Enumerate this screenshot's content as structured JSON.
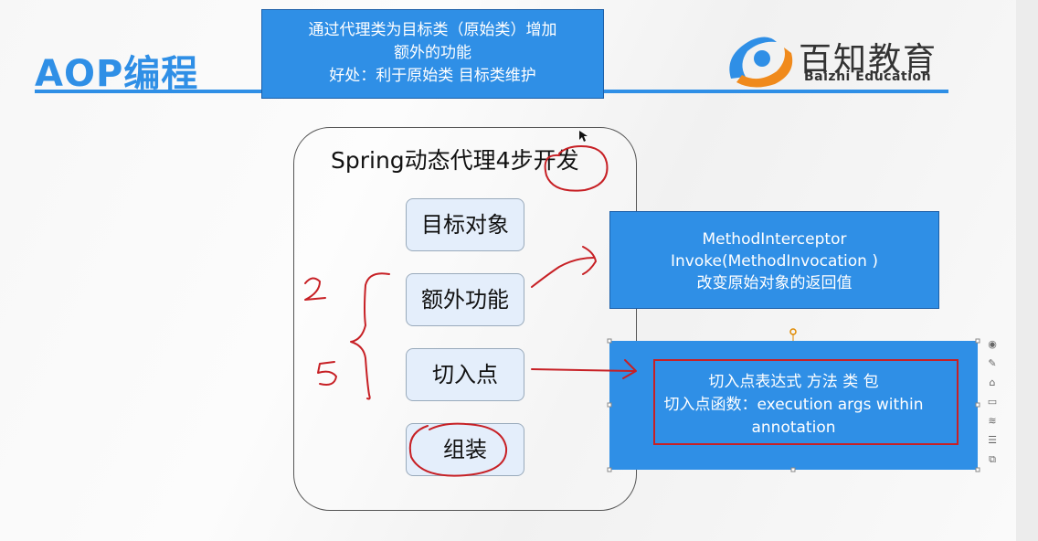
{
  "slide": {
    "title": "AOP编程",
    "top_note": {
      "line1": "通过代理类为目标类（原始类）增加",
      "line2": "额外的功能",
      "line3": "好处：利于原始类 目标类维护"
    },
    "logo": {
      "name": "百知教育",
      "subtitle": "Baizhi Education"
    },
    "panel": {
      "title": "Spring动态代理4步开发",
      "steps": [
        "目标对象",
        "额外功能",
        "切入点",
        "组装"
      ]
    },
    "extra_note": {
      "line1": "MethodInterceptor",
      "line2": "Invoke(MethodInvocation )",
      "line3": "改变原始对象的返回值"
    },
    "pointcut_note": {
      "line1": "切入点表达式 方法 类 包",
      "line2": "切入点函数：execution args within",
      "line3": "annotation"
    },
    "colors": {
      "accent": "#2f8fe6",
      "ink": "#c72025"
    }
  },
  "toolbar": {
    "icons": [
      "circle-icon",
      "pen-icon",
      "home-icon",
      "screen-icon",
      "layers-icon",
      "settings-icon",
      "copy-icon"
    ]
  }
}
